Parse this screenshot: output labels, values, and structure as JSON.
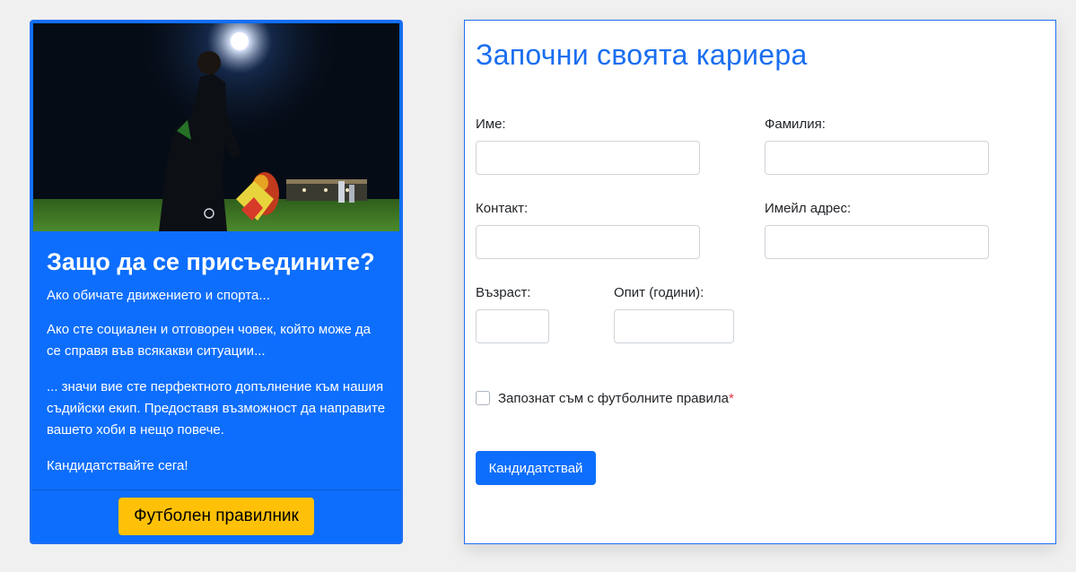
{
  "info_card": {
    "title": "Защо да се присъедините?",
    "paragraph_1": "Ако обичате движението и спорта...",
    "paragraph_2": "Ако сте социален и отговорен човек, който може да се справя във всякакви ситуации...",
    "paragraph_3": "... значи вие сте перфектното допълнение към нашия съдийски екип. Предоставя възможност да направите вашето хоби в нещо повече.",
    "paragraph_4": "Кандидатствайте сега!",
    "rules_button_label": "Футболен правилник"
  },
  "form": {
    "title": "Започни своята кариера",
    "first_name_label": "Име:",
    "last_name_label": "Фамилия:",
    "contact_label": "Контакт:",
    "email_label": "Имейл адрес:",
    "age_label": "Възраст:",
    "experience_label": "Опит (години):",
    "first_name_value": "",
    "last_name_value": "",
    "contact_value": "",
    "email_value": "",
    "age_value": "",
    "experience_value": "",
    "rules_checkbox_label": "Запознат съм с футболните правила",
    "required_marker": "*",
    "rules_checkbox_checked": false,
    "submit_label": "Кандидатствай"
  },
  "colors": {
    "primary": "#0d6efd",
    "warning": "#ffc107",
    "title_blue": "#1a6ef0",
    "danger": "#dc3545"
  }
}
